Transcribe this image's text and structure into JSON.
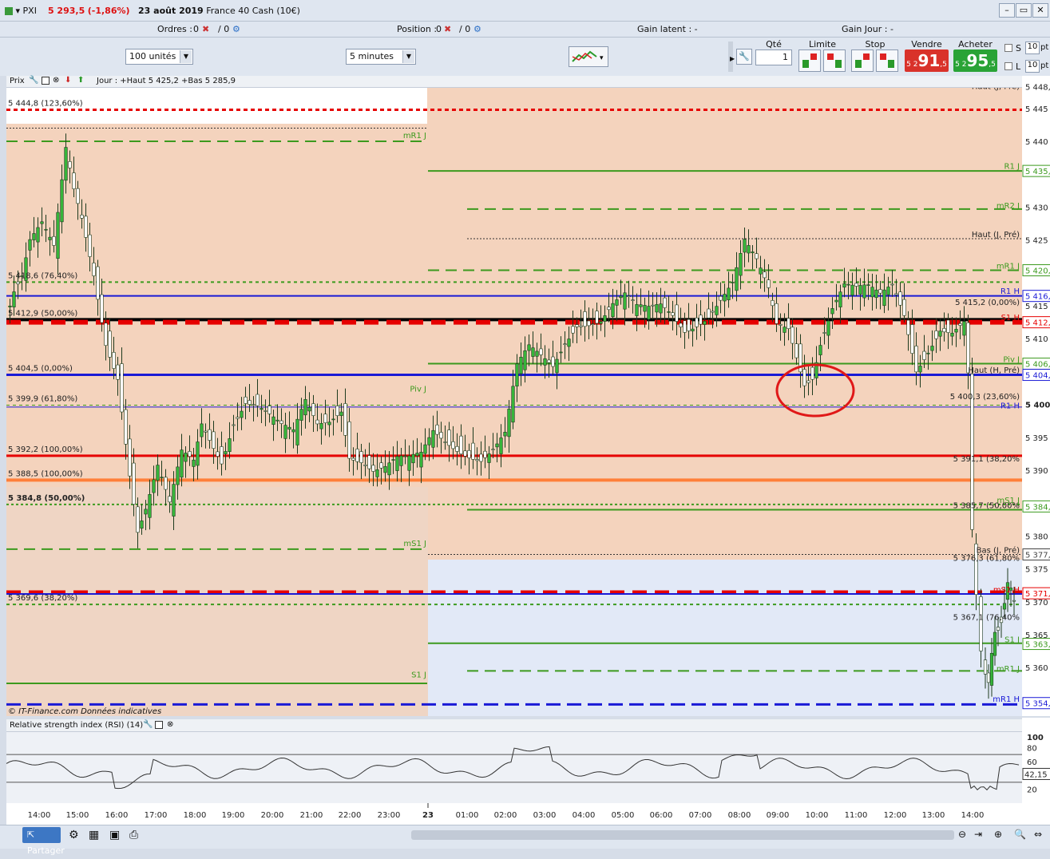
{
  "window": {
    "app_label": "PXI",
    "price": "5 293,5",
    "change": "(-1,86%)",
    "date": "23 août 2019",
    "instrument": "France 40 Cash (10€)"
  },
  "status_row": {
    "orders_label": "Ordres :",
    "orders_value": "0",
    "orders_sep": "/ 0",
    "position_label": "Position :",
    "position_value": "0",
    "position_sep": "/ 0",
    "gain_latent": "Gain latent : -",
    "gain_jour": "Gain Jour : -"
  },
  "toolbar": {
    "units_select": "100 unités",
    "timeframe_select": "5 minutes",
    "qty_label": "Qté",
    "qty_value": "1",
    "limit_label": "Limite",
    "stop_label": "Stop",
    "sell_label": "Vendre",
    "buy_label": "Acheter",
    "sell_prefix": "5 2",
    "sell_big": "91",
    "sell_suffix": ",5",
    "buy_prefix": "5 2",
    "buy_big": "95",
    "buy_suffix": ",5",
    "s_label": "S",
    "l_label": "L",
    "pts_value": "10",
    "pts_label": "pt"
  },
  "chart_header": {
    "prix_label": "Prix",
    "indicator_text": "Jour : +Haut 5 425,2 +Bas 5 285,9"
  },
  "left_labels": [
    "5 444,8 (123,60%)",
    "5 418,6 (76,40%)",
    "5 412,9 (50,00%)",
    "5 404,5 (0,00%)",
    "5 399,9 (61,80%)",
    "5 392,2 (100,00%)",
    "5 388,5 (100,00%)",
    "5 384,8 (50,00%)",
    "5 369,6 (38,20%)"
  ],
  "mid_labels": [
    "mR1 J",
    "Piv J",
    "mS1 J",
    "S1 J"
  ],
  "right_labels": [
    "Haut (J, Pré)",
    "R1 J",
    "mR2 J",
    "Haut (J, Pré)",
    "mR1 J",
    "R1 H",
    "5 415,2 (0,00%)",
    "S1 H",
    "Piv J",
    "Haut (H, Pré)",
    "5 400,3 (23,60%)",
    "R1 H",
    "5 391,1 (38,20%",
    "mS1 J",
    "5 385,7 (50,00%",
    "Bas (J, Pré)",
    "5 376,3 (61,80%",
    "mS1 H",
    "5 367,1 (76,40%",
    "S1 J",
    "mR1 J",
    "mR1 H"
  ],
  "axis_ticks": [
    "5 448,",
    "5 445",
    "5 440",
    "5 435,",
    "5 430",
    "5 425",
    "5 420,",
    "5 416,",
    "5 415",
    "5 412,",
    "5 410",
    "5 406,",
    "5 404,",
    "5 400",
    "5 395",
    "5 390",
    "5 384,",
    "5 380",
    "5 377,",
    "5 375",
    "5 371,",
    "5 370",
    "5 365",
    "5 363,",
    "5 360",
    "5 354,"
  ],
  "time_ticks": [
    "14:00",
    "15:00",
    "16:00",
    "17:00",
    "18:00",
    "19:00",
    "20:00",
    "21:00",
    "22:00",
    "23:00",
    "23",
    "01:00",
    "02:00",
    "03:00",
    "04:00",
    "05:00",
    "06:00",
    "07:00",
    "08:00",
    "09:00",
    "10:00",
    "11:00",
    "12:00",
    "13:00",
    "14:00"
  ],
  "watermark": "© IT-Finance.com  Données indicatives",
  "rsi": {
    "title": "Relative strength index (RSI) (14)",
    "ticks": [
      "100",
      "80",
      "60",
      "40",
      "20"
    ],
    "value": "42,15"
  },
  "statusbar": {
    "share_label": "Partager"
  },
  "colors": {
    "support": "#e60000",
    "pivot_blue": "#1a1ad6",
    "green": "#3c9a1e",
    "orange": "#ff7f3a",
    "sell": "#d9322a",
    "buy": "#29a336"
  },
  "chart_data": {
    "type": "candlestick",
    "instrument": "France 40 Cash (10€)",
    "timeframe": "5 minutes",
    "x_range": [
      "14:00",
      "14:00"
    ],
    "ylim": [
      5354,
      5448
    ],
    "key_levels": [
      {
        "label": "5 444,8 (123,60%)",
        "value": 5444.8
      },
      {
        "label": "5 418,6 (76,40%)",
        "value": 5418.6
      },
      {
        "label": "5 412,9 (50,00%)",
        "value": 5412.9
      },
      {
        "label": "5 404,5 (0,00%)",
        "value": 5404.5
      },
      {
        "label": "5 399,9 (61,80%)",
        "value": 5399.9
      },
      {
        "label": "5 392,2 (100,00%)",
        "value": 5392.2
      },
      {
        "label": "5 388,5 (100,00%)",
        "value": 5388.5
      },
      {
        "label": "5 384,8 (50,00%)",
        "value": 5384.8
      },
      {
        "label": "5 369,6 (38,20%)",
        "value": 5369.6
      }
    ],
    "day_high": 5425.2,
    "day_low": 5285.9
  }
}
